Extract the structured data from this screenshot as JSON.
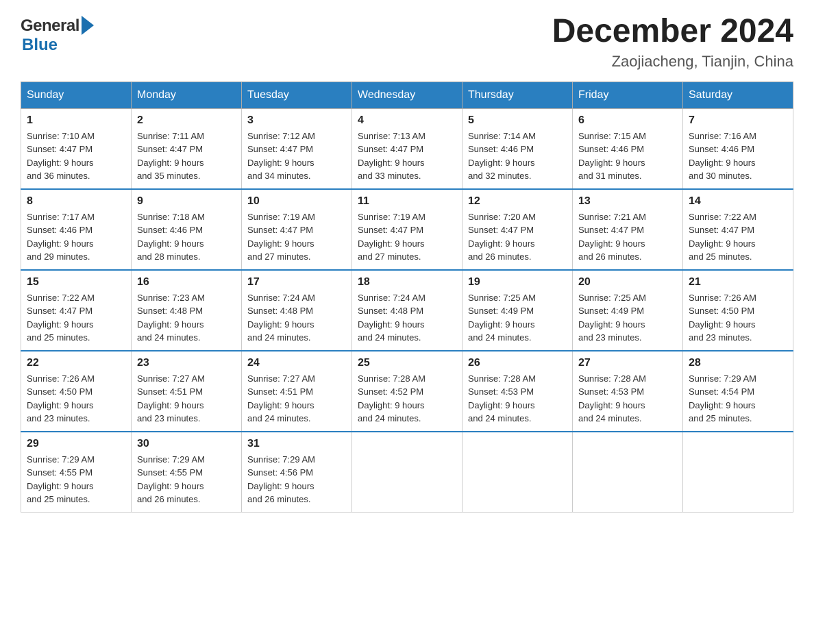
{
  "logo": {
    "name_general": "General",
    "name_blue": "Blue"
  },
  "title": "December 2024",
  "subtitle": "Zaojiacheng, Tianjin, China",
  "days_of_week": [
    "Sunday",
    "Monday",
    "Tuesday",
    "Wednesday",
    "Thursday",
    "Friday",
    "Saturday"
  ],
  "weeks": [
    [
      {
        "day": "1",
        "sunrise": "7:10 AM",
        "sunset": "4:47 PM",
        "daylight": "9 hours and 36 minutes."
      },
      {
        "day": "2",
        "sunrise": "7:11 AM",
        "sunset": "4:47 PM",
        "daylight": "9 hours and 35 minutes."
      },
      {
        "day": "3",
        "sunrise": "7:12 AM",
        "sunset": "4:47 PM",
        "daylight": "9 hours and 34 minutes."
      },
      {
        "day": "4",
        "sunrise": "7:13 AM",
        "sunset": "4:47 PM",
        "daylight": "9 hours and 33 minutes."
      },
      {
        "day": "5",
        "sunrise": "7:14 AM",
        "sunset": "4:46 PM",
        "daylight": "9 hours and 32 minutes."
      },
      {
        "day": "6",
        "sunrise": "7:15 AM",
        "sunset": "4:46 PM",
        "daylight": "9 hours and 31 minutes."
      },
      {
        "day": "7",
        "sunrise": "7:16 AM",
        "sunset": "4:46 PM",
        "daylight": "9 hours and 30 minutes."
      }
    ],
    [
      {
        "day": "8",
        "sunrise": "7:17 AM",
        "sunset": "4:46 PM",
        "daylight": "9 hours and 29 minutes."
      },
      {
        "day": "9",
        "sunrise": "7:18 AM",
        "sunset": "4:46 PM",
        "daylight": "9 hours and 28 minutes."
      },
      {
        "day": "10",
        "sunrise": "7:19 AM",
        "sunset": "4:47 PM",
        "daylight": "9 hours and 27 minutes."
      },
      {
        "day": "11",
        "sunrise": "7:19 AM",
        "sunset": "4:47 PM",
        "daylight": "9 hours and 27 minutes."
      },
      {
        "day": "12",
        "sunrise": "7:20 AM",
        "sunset": "4:47 PM",
        "daylight": "9 hours and 26 minutes."
      },
      {
        "day": "13",
        "sunrise": "7:21 AM",
        "sunset": "4:47 PM",
        "daylight": "9 hours and 26 minutes."
      },
      {
        "day": "14",
        "sunrise": "7:22 AM",
        "sunset": "4:47 PM",
        "daylight": "9 hours and 25 minutes."
      }
    ],
    [
      {
        "day": "15",
        "sunrise": "7:22 AM",
        "sunset": "4:47 PM",
        "daylight": "9 hours and 25 minutes."
      },
      {
        "day": "16",
        "sunrise": "7:23 AM",
        "sunset": "4:48 PM",
        "daylight": "9 hours and 24 minutes."
      },
      {
        "day": "17",
        "sunrise": "7:24 AM",
        "sunset": "4:48 PM",
        "daylight": "9 hours and 24 minutes."
      },
      {
        "day": "18",
        "sunrise": "7:24 AM",
        "sunset": "4:48 PM",
        "daylight": "9 hours and 24 minutes."
      },
      {
        "day": "19",
        "sunrise": "7:25 AM",
        "sunset": "4:49 PM",
        "daylight": "9 hours and 24 minutes."
      },
      {
        "day": "20",
        "sunrise": "7:25 AM",
        "sunset": "4:49 PM",
        "daylight": "9 hours and 23 minutes."
      },
      {
        "day": "21",
        "sunrise": "7:26 AM",
        "sunset": "4:50 PM",
        "daylight": "9 hours and 23 minutes."
      }
    ],
    [
      {
        "day": "22",
        "sunrise": "7:26 AM",
        "sunset": "4:50 PM",
        "daylight": "9 hours and 23 minutes."
      },
      {
        "day": "23",
        "sunrise": "7:27 AM",
        "sunset": "4:51 PM",
        "daylight": "9 hours and 23 minutes."
      },
      {
        "day": "24",
        "sunrise": "7:27 AM",
        "sunset": "4:51 PM",
        "daylight": "9 hours and 24 minutes."
      },
      {
        "day": "25",
        "sunrise": "7:28 AM",
        "sunset": "4:52 PM",
        "daylight": "9 hours and 24 minutes."
      },
      {
        "day": "26",
        "sunrise": "7:28 AM",
        "sunset": "4:53 PM",
        "daylight": "9 hours and 24 minutes."
      },
      {
        "day": "27",
        "sunrise": "7:28 AM",
        "sunset": "4:53 PM",
        "daylight": "9 hours and 24 minutes."
      },
      {
        "day": "28",
        "sunrise": "7:29 AM",
        "sunset": "4:54 PM",
        "daylight": "9 hours and 25 minutes."
      }
    ],
    [
      {
        "day": "29",
        "sunrise": "7:29 AM",
        "sunset": "4:55 PM",
        "daylight": "9 hours and 25 minutes."
      },
      {
        "day": "30",
        "sunrise": "7:29 AM",
        "sunset": "4:55 PM",
        "daylight": "9 hours and 26 minutes."
      },
      {
        "day": "31",
        "sunrise": "7:29 AM",
        "sunset": "4:56 PM",
        "daylight": "9 hours and 26 minutes."
      },
      null,
      null,
      null,
      null
    ]
  ],
  "labels": {
    "sunrise": "Sunrise: ",
    "sunset": "Sunset: ",
    "daylight": "Daylight: "
  }
}
